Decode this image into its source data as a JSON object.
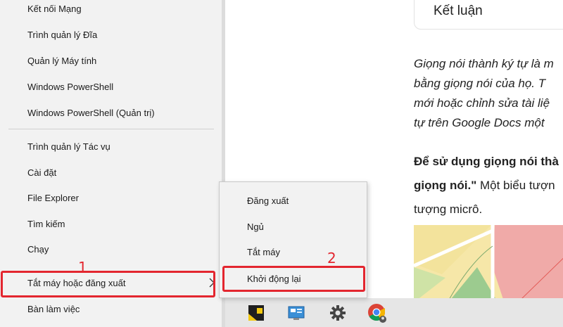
{
  "winx_menu": {
    "items": [
      {
        "label": "Kết nối Mạng"
      },
      {
        "label": "Trình quản lý Đĩa"
      },
      {
        "label": "Quản lý Máy tính"
      },
      {
        "label": "Windows PowerShell"
      },
      {
        "label": "Windows PowerShell (Quản trị)"
      },
      {
        "label": "Trình quản lý Tác vụ"
      },
      {
        "label": "Cài đặt"
      },
      {
        "label": "File Explorer"
      },
      {
        "label": "Tìm kiếm"
      },
      {
        "label": "Chạy"
      },
      {
        "label": "Tắt máy hoặc đăng xuất"
      },
      {
        "label": "Bàn làm việc"
      }
    ]
  },
  "power_submenu": {
    "items": [
      {
        "label": "Đăng xuất"
      },
      {
        "label": "Ngủ"
      },
      {
        "label": "Tắt máy"
      },
      {
        "label": "Khởi động lại"
      }
    ]
  },
  "annotations": {
    "step1": "1",
    "step2": "2",
    "color": "#e3262f"
  },
  "article": {
    "toc_title": "Kết luận",
    "para1_lines": [
      "Giọng nói thành ký tự là m",
      "bằng giọng nói của họ. T",
      "mới hoặc chỉnh sửa tài liệ",
      "tự trên Google Docs một"
    ],
    "para2": {
      "line1_bold": "Để sử dụng giọng nói thà",
      "line2_bold": "giọng nói.\"",
      "line2_rest": " Một biểu tượn",
      "line3": "tượng micrô."
    }
  },
  "taskbar": {
    "icons": [
      "sticky-notes-icon",
      "control-panel-icon",
      "settings-gear-icon",
      "chrome-icon"
    ]
  }
}
